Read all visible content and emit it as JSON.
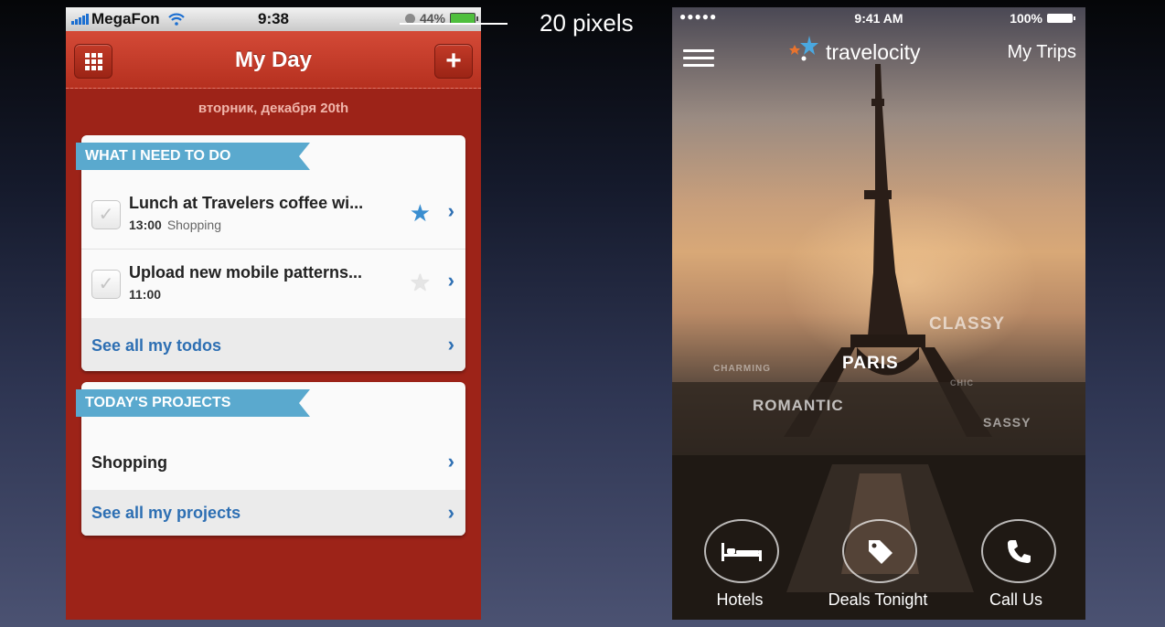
{
  "left_app": {
    "status_bar": {
      "carrier": "MegaFon",
      "time": "9:38",
      "battery": "44%"
    },
    "nav": {
      "title": "My Day",
      "add_label": "+"
    },
    "date": "вторник, декабря 20th",
    "todos_section": {
      "heading": "WHAT I NEED TO DO",
      "items": [
        {
          "title": "Lunch at Travelers coffee wi...",
          "time": "13:00",
          "tag": "Shopping",
          "starred": true
        },
        {
          "title": "Upload new mobile patterns...",
          "time": "11:00",
          "tag": "",
          "starred": false
        }
      ],
      "see_all": "See all my todos"
    },
    "projects_section": {
      "heading": "TODAY'S PROJECTS",
      "items": [
        {
          "title": "Shopping"
        }
      ],
      "see_all": "See all my projects"
    }
  },
  "annotation": {
    "label": "20 pixels"
  },
  "right_app": {
    "status_bar": {
      "signal": "●●●●●",
      "time": "9:41 AM",
      "battery": "100%"
    },
    "logo_text": "travelocity",
    "my_trips": "My Trips",
    "words": {
      "paris": "PARIS",
      "classy": "CLASSY",
      "romantic": "ROMANTIC",
      "charming": "CHARMING",
      "sassy": "SASSY",
      "chic": "CHIC"
    },
    "actions": [
      {
        "label": "Hotels",
        "icon": "bed-icon"
      },
      {
        "label": "Deals Tonight",
        "icon": "tag-icon"
      },
      {
        "label": "Call Us",
        "icon": "phone-icon"
      }
    ]
  },
  "colors": {
    "accent_red": "#b5301f",
    "ribbon_blue": "#5aa9ce",
    "link_blue": "#2d6fb3"
  }
}
